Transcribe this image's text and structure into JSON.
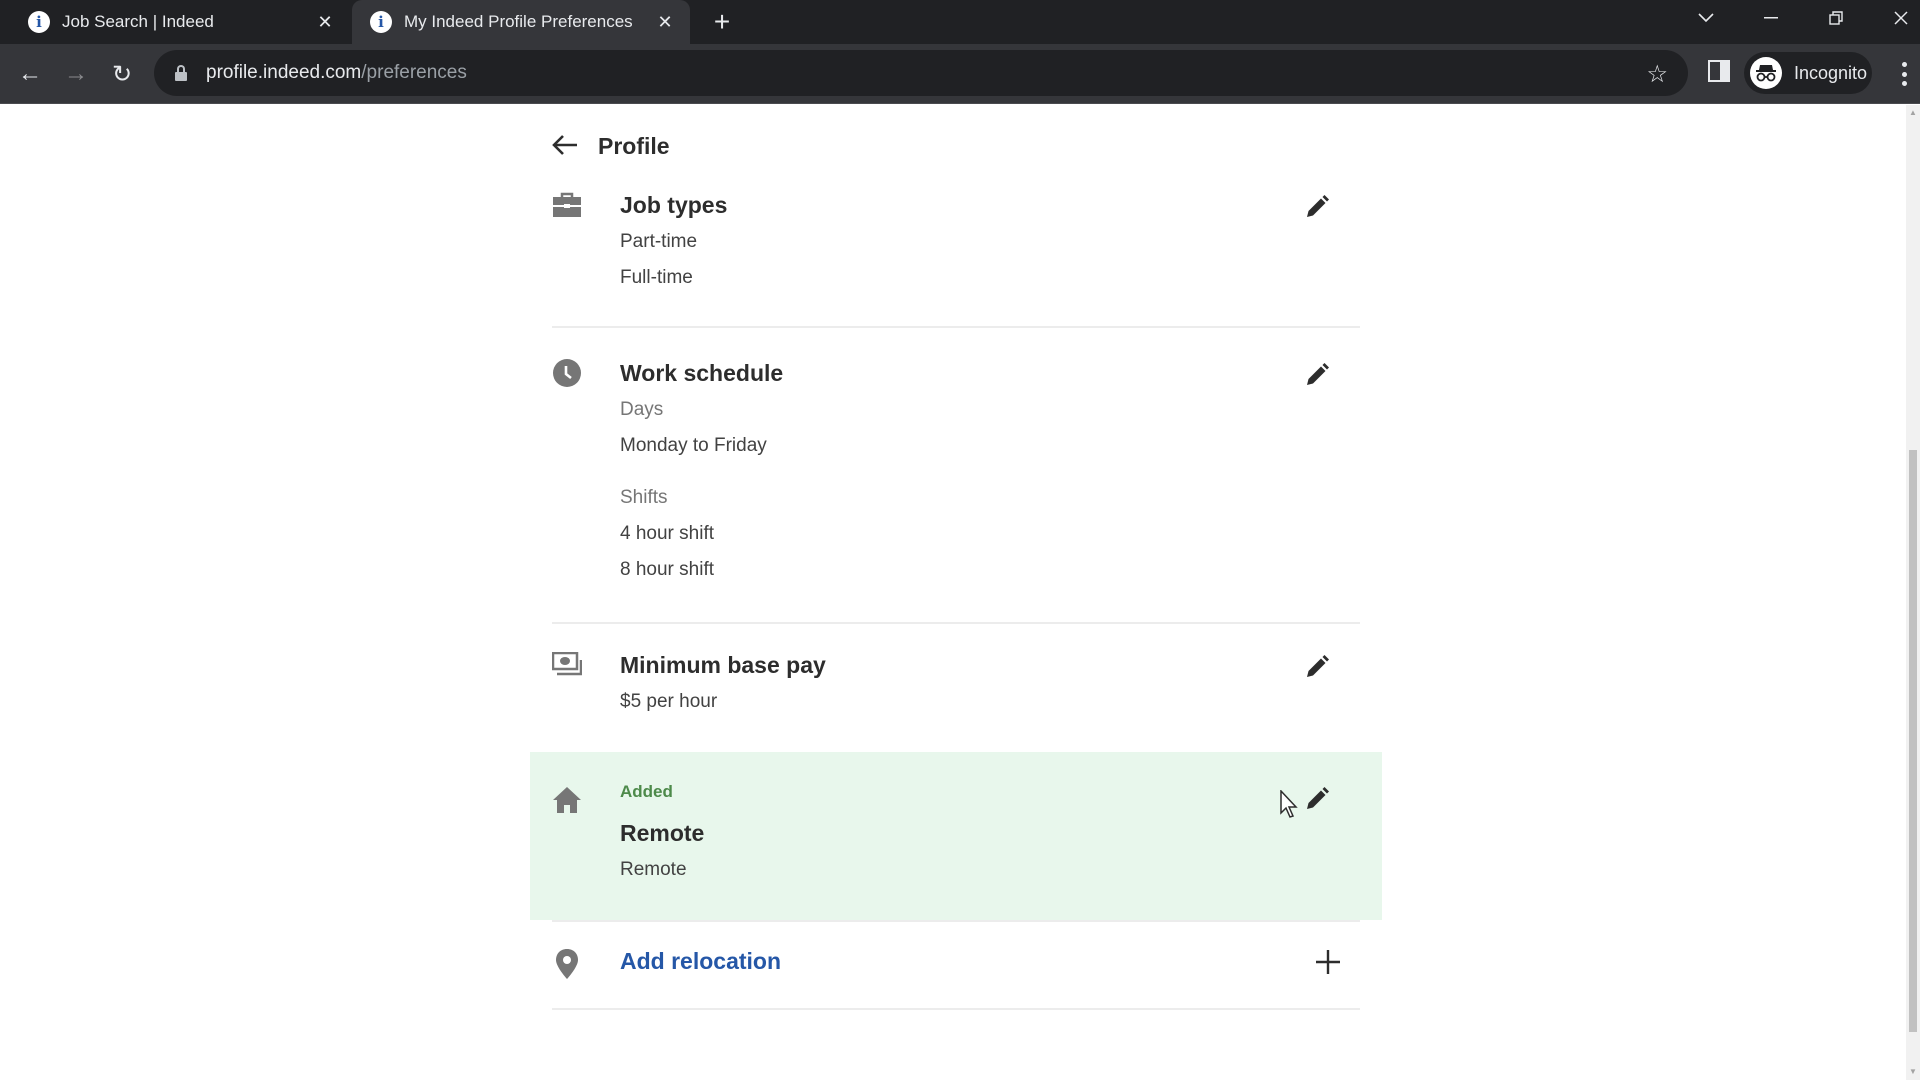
{
  "browser": {
    "tabs": [
      {
        "title": "Job Search | Indeed",
        "active": false,
        "favicon": "indeed-info-icon"
      },
      {
        "title": "My Indeed Profile Preferences",
        "active": true,
        "favicon": "indeed-info-icon"
      }
    ],
    "new_tab_label": "+",
    "url": {
      "host": "profile.indeed.com",
      "path": "/preferences"
    },
    "profile_label": "Incognito",
    "icons": {
      "back": "←",
      "forward": "→",
      "reload": "↻",
      "star": "☆",
      "tab_close": "✕",
      "minimize": "—",
      "restore": "❐",
      "close": "✕",
      "tab_search": "⌄"
    }
  },
  "page": {
    "back_link": {
      "arrow": "←",
      "label": "Profile"
    },
    "sections": [
      {
        "id": "job-types",
        "icon": "briefcase-icon",
        "title": "Job types",
        "values": [
          "Part-time",
          "Full-time"
        ]
      },
      {
        "id": "work-schedule",
        "icon": "clock-icon",
        "title": "Work schedule",
        "groups": [
          {
            "label": "Days",
            "values": [
              "Monday to Friday"
            ]
          },
          {
            "label": "Shifts",
            "values": [
              "4 hour shift",
              "8 hour shift"
            ]
          }
        ]
      },
      {
        "id": "minimum-base-pay",
        "icon": "money-icon",
        "title": "Minimum base pay",
        "values": [
          "$5 per hour"
        ]
      },
      {
        "id": "remote",
        "icon": "home-icon",
        "status": "Added",
        "title": "Remote",
        "values": [
          "Remote"
        ],
        "highlighted": true
      }
    ],
    "add_relocation": {
      "icon": "location-pin-icon",
      "label": "Add relocation",
      "action_icon": "+"
    }
  },
  "colors": {
    "brand_blue": "#2557a7",
    "added_green": "#4d8a4a",
    "highlight_bg": "#e8f7ec"
  }
}
